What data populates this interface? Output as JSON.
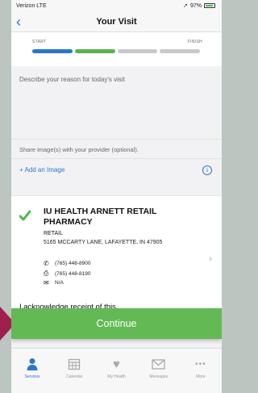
{
  "status": {
    "carrier": "Verizon LTE",
    "battery": "97%"
  },
  "nav": {
    "title": "Your Visit"
  },
  "progress": {
    "start": "START",
    "finish": "FINISH"
  },
  "reason": {
    "label": "Describe your reason for today's visit"
  },
  "share": {
    "label": "Share image(s) with your provider (optional).",
    "add_label": "+ Add an Image"
  },
  "pharmacy": {
    "name": "IU HEALTH ARNETT RETAIL PHARMACY",
    "type": "RETAIL",
    "address": "5165 MCCARTY LANE, LAFAYETTE, IN 47905",
    "phone": "(765) 448-8900",
    "fax": "(765) 448-8190",
    "email": "N/A"
  },
  "acknowledge": {
    "text": "I acknowledge receipt of this"
  },
  "continue_label": "Continue",
  "tabs": [
    {
      "label": "Services"
    },
    {
      "label": "Calendar"
    },
    {
      "label": "My Health"
    },
    {
      "label": "Messages"
    },
    {
      "label": "More"
    }
  ]
}
